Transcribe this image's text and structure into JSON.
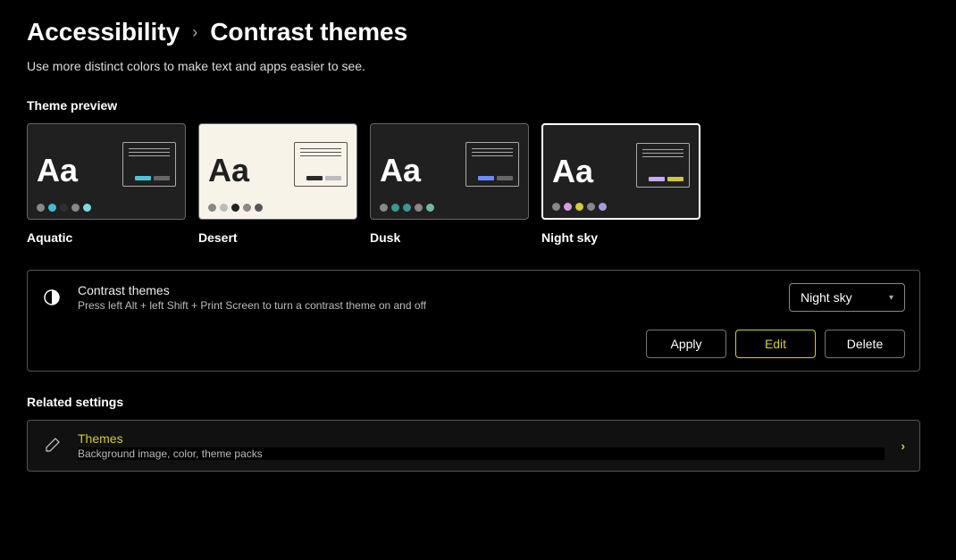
{
  "breadcrumb": {
    "parent": "Accessibility",
    "current": "Contrast themes"
  },
  "subtitle": "Use more distinct colors to make text and apps easier to see.",
  "preview_header": "Theme preview",
  "themes": [
    {
      "name": "Aquatic",
      "bg": "#202020",
      "fg": "#ffffff",
      "border": "#aaaaaa",
      "btn1": "#4fc3d9",
      "btn2": "#666666",
      "swatches": [
        "#888888",
        "#3fbfd0",
        "#2f2f2f",
        "#888888",
        "#7fd8e0"
      ]
    },
    {
      "name": "Desert",
      "bg": "#f7f3e9",
      "fg": "#202020",
      "border": "#555555",
      "btn1": "#2a2a2a",
      "btn2": "#bbbbbb",
      "swatches": [
        "#888888",
        "#bbbbbb",
        "#222222",
        "#888888",
        "#555555"
      ]
    },
    {
      "name": "Dusk",
      "bg": "#202020",
      "fg": "#ffffff",
      "border": "#aaaaaa",
      "btn1": "#6a8cff",
      "btn2": "#666666",
      "swatches": [
        "#888888",
        "#3d9690",
        "#3d9690",
        "#888888",
        "#6fb8a8"
      ]
    },
    {
      "name": "Night sky",
      "bg": "#202020",
      "fg": "#ffffff",
      "border": "#aaaaaa",
      "btn1": "#c9a8ff",
      "btn2": "#cfc640",
      "swatches": [
        "#888888",
        "#d89ae0",
        "#d4cc3a",
        "#888888",
        "#a89cd8"
      ],
      "selected": true
    }
  ],
  "setting": {
    "title": "Contrast themes",
    "sub": "Press left Alt + left Shift + Print Screen to turn a contrast theme on and off",
    "selected": "Night sky",
    "buttons": {
      "apply": "Apply",
      "edit": "Edit",
      "delete": "Delete"
    }
  },
  "related": {
    "header": "Related settings",
    "title": "Themes",
    "sub": "Background image, color, theme packs"
  }
}
